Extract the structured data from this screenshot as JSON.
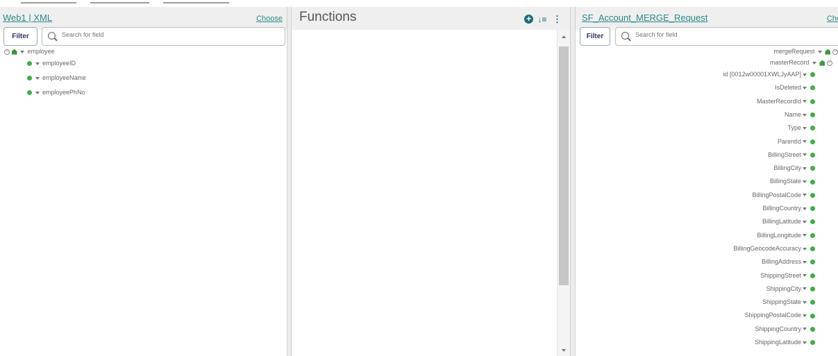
{
  "left_panel": {
    "title": "Web1 | XML",
    "choose": "Choose",
    "filter_label": "Filter",
    "search_placeholder": "Search for field",
    "tree": [
      {
        "label": "employee",
        "type": "group"
      },
      {
        "label": "employeeID",
        "type": "field"
      },
      {
        "label": "employeeName",
        "type": "field"
      },
      {
        "label": "employeePhNo",
        "type": "field"
      }
    ]
  },
  "mid_panel": {
    "title": "Functions",
    "add_icon": "plus-circle-icon",
    "sort_icon": "sort-icon",
    "menu_icon": "kebab-menu-icon"
  },
  "right_panel": {
    "title": "SF_Account_MERGE_Request",
    "choose": "Cho",
    "filter_label": "Filter",
    "search_placeholder": "Search for field",
    "root": "mergeRequest",
    "group": "masterRecord",
    "fields": [
      "id [0012w00001XWLJyAAP]",
      "IsDeleted",
      "MasterRecordId",
      "Name",
      "Type",
      "ParentId",
      "BillingStreet",
      "BillingCity",
      "BillingState",
      "BillingPostalCode",
      "BillingCountry",
      "BillingLatitude",
      "BillingLongitude",
      "BillingGeocodeAccuracy",
      "BillingAddress",
      "ShippingStreet",
      "ShippingCity",
      "ShippingState",
      "ShippingPostalCode",
      "ShippingCountry",
      "ShippingLatitude"
    ]
  },
  "colors": {
    "accent": "#2a8a8a",
    "field_dot": "#3cb043",
    "header_bg": "#efefef"
  }
}
